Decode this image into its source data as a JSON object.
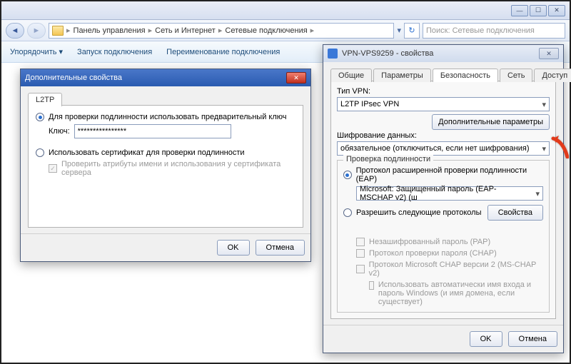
{
  "titlebar": {
    "min": "—",
    "max": "☐",
    "close": "✕"
  },
  "addrbar": {
    "breadcrumbs": [
      "Панель управления",
      "Сеть и Интернет",
      "Сетевые подключения"
    ],
    "search_placeholder": "Поиск: Сетевые подключения"
  },
  "toolbar": {
    "organize": "Упорядочить ▾",
    "start": "Запуск подключения",
    "rename": "Переименование подключения"
  },
  "advDlg": {
    "title": "Дополнительные свойства",
    "tab": "L2TP",
    "radio1": "Для проверки подлинности использовать предварительный ключ",
    "key_label": "Ключ:",
    "key_value": "****************",
    "radio2": "Использовать сертификат для проверки подлинности",
    "check_cert": "Проверить атрибуты имени и использования у сертификата сервера",
    "ok": "OK",
    "cancel": "Отмена"
  },
  "propsDlg": {
    "title": "VPN-VPS9259 - свойства",
    "tabs": [
      "Общие",
      "Параметры",
      "Безопасность",
      "Сеть",
      "Доступ"
    ],
    "active_tab": 2,
    "type_label": "Тип VPN:",
    "type_value": "L2TP IPsec VPN",
    "adv_btn": "Дополнительные параметры",
    "enc_label": "Шифрование данных:",
    "enc_value": "обязательное (отключиться, если нет шифрования)",
    "auth_legend": "Проверка подлинности",
    "eap_radio": "Протокол расширенной проверки подлинности (EAP)",
    "eap_value": "Microsoft: Защищенный пароль (EAP-MSCHAP v2) (ш",
    "props_btn": "Свойства",
    "allow_radio": "Разрешить следующие протоколы",
    "pap": "Незашифрованный пароль (PAP)",
    "chap": "Протокол проверки пароля (CHAP)",
    "mschap": "Протокол Microsoft CHAP версии 2 (MS-CHAP v2)",
    "auto_cred": "Использовать автоматически имя входа и пароль Windows (и имя домена, если существует)",
    "ok": "OK",
    "cancel": "Отмена"
  }
}
